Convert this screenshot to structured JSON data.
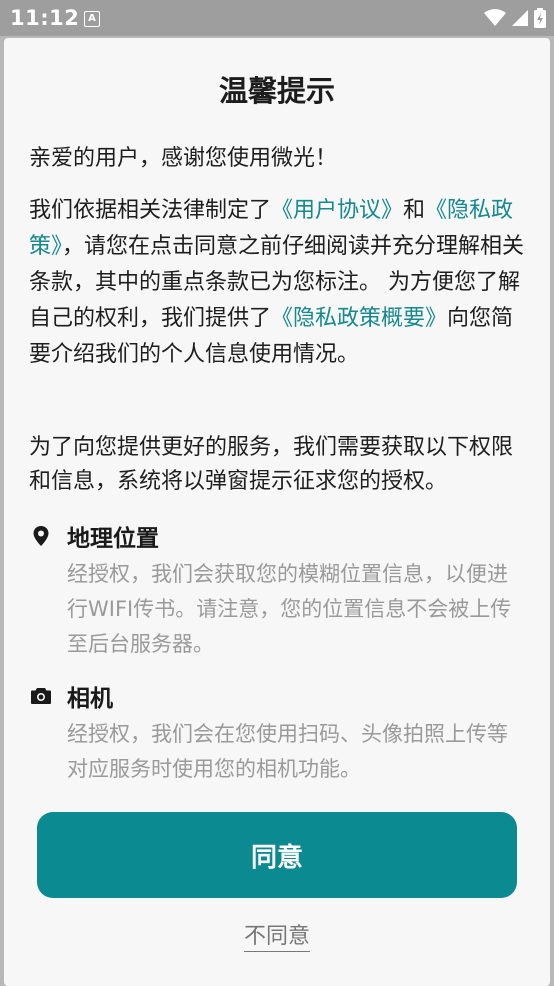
{
  "status_bar": {
    "time": "11:12",
    "notification_icon": "A",
    "icons": [
      "wifi-icon",
      "signal-icon",
      "battery-icon"
    ]
  },
  "dialog": {
    "title": "温馨提示",
    "greeting": "亲爱的用户，感谢您使用微光！",
    "para1": {
      "t1": "我们依据相关法律制定了",
      "link_user_agreement": "《用户协议》",
      "t2": "和",
      "link_privacy_policy": "《隐私政策》",
      "t3": "，请您在点击同意之前仔细阅读并充分理解相关条款，其中的重点条款已为您标注。 为方便您了解自己的权利，我们提供了",
      "link_privacy_summary": "《隐私政策概要》",
      "t4": "向您简要介绍我们的个人信息使用情况。"
    },
    "para2": "为了向您提供更好的服务，我们需要获取以下权限和信息，系统将以弹窗提示征求您的授权。",
    "permissions": [
      {
        "icon": "location-pin-icon",
        "title": "地理位置",
        "desc": "经授权，我们会获取您的模糊位置信息，以便进行WIFI传书。请注意，您的位置信息不会被上传至后台服务器。"
      },
      {
        "icon": "camera-icon",
        "title": "相机",
        "desc": "经授权，我们会在您使用扫码、头像拍照上传等对应服务时使用您的相机功能。"
      }
    ],
    "agree_label": "同意",
    "disagree_label": "不同意"
  },
  "colors": {
    "accent": "#0b8a92",
    "link": "#14898f",
    "status_bar": "#9e9e9e"
  }
}
